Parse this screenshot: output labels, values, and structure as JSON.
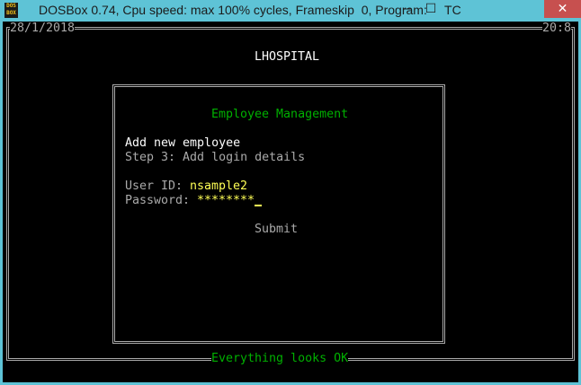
{
  "window": {
    "title": "DOSBox 0.74, Cpu speed: max 100% cycles, Frameskip  0, Program:     TC",
    "icon": "dosbox-icon",
    "icon_text": "DOS BOX",
    "buttons": {
      "minimize": "‒",
      "maximize": "☐",
      "close": "✕"
    }
  },
  "screen": {
    "date": "28/1/2018",
    "time": "20:8",
    "app_title": "LHOSPITAL",
    "dialog": {
      "title": "Employee Management",
      "heading": "Add new employee",
      "step": "Step 3: Add login details",
      "user_id_label": "User ID:",
      "user_id_value": "nsample2",
      "password_label": "Password:",
      "password_value": "********",
      "submit_label": "Submit"
    },
    "status": "Everything looks OK"
  },
  "colors": {
    "gray": "#aaaaaa",
    "white": "#ffffff",
    "green": "#00b000",
    "yellow": "#ffff55",
    "titlebar": "#5ec3d6"
  }
}
